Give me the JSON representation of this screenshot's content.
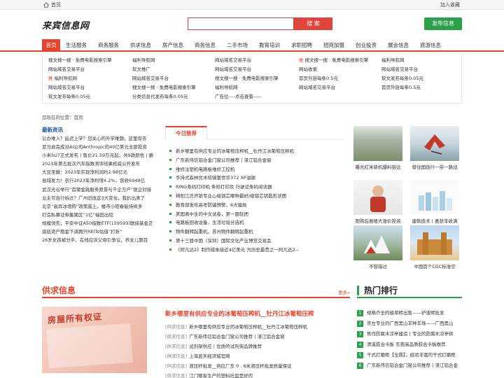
{
  "topbar": {
    "home_label": "首页",
    "favorite_label": "加入收藏"
  },
  "header": {
    "logo": "来宾信息网",
    "search_placeholder": "",
    "search_button": "搜 索",
    "publish_button": "发布信息"
  },
  "nav": {
    "items": [
      "首页",
      "生活服务",
      "商务服务",
      "供求信息",
      "房产信息",
      "商务信息",
      "二手市场",
      "教育培训",
      "求职招聘",
      "招商加盟",
      "创业投资",
      "展会信息",
      "旅游信息"
    ]
  },
  "quick_links": {
    "col1": [
      "搜文搜一搜 · 免费电影搜索引擎",
      "网站域名交易平台",
      "推 福利导航网",
      "网站域名交易平台",
      "软文发布每条0.05元"
    ],
    "col2": [
      "福利导航网",
      "软文推广",
      "网站域名交易平台",
      "搜文搜一搜 · 免费电影搜索引擎",
      "分类信息代发布每条0.05元"
    ],
    "col3": [
      "网站域名交易平台",
      "网站域名交易平台",
      "搜文搜一搜 · 免费电影搜索引擎",
      "福利导航网",
      "广告位----点击查看-----"
    ],
    "col4": [
      "推 搜文搜一搜 · 免费电影搜索引擎",
      "网站收录",
      "首页外链每条0.5元",
      "网站域名交易平台"
    ],
    "col5": [
      "福利导航网",
      "网站域名交易平台",
      "软文发布每条0.05元",
      "首页外链每条0.5元"
    ]
  },
  "location": "您现在的位置：首页",
  "latest_news": {
    "title": "最新资讯",
    "items": [
      "公办难入？延迟上学？您关心的升学难题，这里有答",
      "亚马逊完成对AI公司Anthropic的40亿美元全部投资",
      "小米SU7正式发布丨售价21.59万元起，共9款颜色丨爵",
      "2023年第五批次汽车指数测评结果权威公开发布",
      "大显圣徽：2023年实现净利润约2.98亿元",
      "县域发力！农行2023年净利增4.2%，营收6948亿",
      "武汉光谷举行“首聚金融服务愿景与千企万户”银企对接",
      "业主可自行拆迁？广州旧改这3大变化，我扒出来了",
      "北京“高异冰增购”政策座上，楼市小阳春能持续多",
      "打造私募证券集聚区“1亿”福田出招",
      "规模领先，平安中证A50指数ETF(159593)联接基金正",
      "底层资产租金下调再只REITs估值“打折”",
      "26岁女孩被分手，在线控诉父母引争议，养女儿题目"
    ]
  },
  "recommend": {
    "tab": "今日推荐",
    "items": [
      "新乡哪里有供应专业的冰葡萄压榨机__牡丹江冰葡萄压榨机",
      "广东新伟信铝合金门窗公司推荐丨湛江铝合金窗",
      "维修注塑机电路板维修工控机",
      "手持式森林优木结镜富世华372 XP油锯",
      "RING条码打印机 条码打印及 行驶证条码阅读器",
      "绵阳江氏开锁专业心级锁芯哪种最好/级锁芯钥匙形状图",
      "教育部发布高考防骗预警，6大骗局",
      "美国离中生的中文试卷，第一题就把",
      "电路板回收设备，生活垃圾分选机",
      "物件翻转起重机，苏州物件翻转起重机",
      "第十三届中国（深圳）国际文化产业博览交易会",
      "《阿凡达2》制作成本接近4亿美元 为历史最贵之一阿凡达2--"
    ]
  },
  "image_cards": [
    {
      "caption": "曝光红米新机爆料容远"
    },
    {
      "caption": "替往国践行一带一路战"
    },
    {
      "caption": "限购后展楼大涨价投资"
    },
    {
      "caption": "建筑技术丨喜获丰收满"
    },
    {
      "caption": "不容错过"
    },
    {
      "caption": "中国首个CGC标准空"
    }
  ],
  "supply": {
    "title": "供求信息",
    "more": "更多»",
    "image_text": "房屋所有权证",
    "headline": "新乡哪里有供应专业的冰葡萄压榨机__牡丹江冰葡萄压榨",
    "items": [
      {
        "cat": "[供求信息]",
        "text": "新乡哪里有供应专业的冰葡萄压榨机__牡丹江冰葡萄压榨机"
      },
      {
        "cat": "[供求信息]",
        "text": "广东新伟信铝合金门窗公司推荐丨湛江铝合金窗"
      },
      {
        "cat": "[供求信息]",
        "text": "试剂架供应丨优质的试剂架品牌推荐"
      },
      {
        "cat": "[供求信息]",
        "text": "上海蓝天经济城官网"
      },
      {
        "cat": "[供求信息]",
        "text": "液压杆批发__供应厂东 0 . 6米液压杆批发质量保证"
      },
      {
        "cat": "[供求信息]",
        "text": "江门哪家生产的塑料托盘是好的"
      }
    ]
  },
  "hot": {
    "title": "热门排行",
    "items": [
      "规格齐全的植草砖出售——护坡砖批发",
      "崇左专业的广西黑山羊种羊场——广西黑山",
      "焦作防腐木凉亭建造丨专业的防腐木凉亭供",
      "清溪胶合卡板   东莞高品质胶合卡板推荐",
      "干式打磨柜【全鼎】，经验丰富的干式打磨柜",
      "广东新伟信铝合金门窗公司推荐丨湛江铝合金"
    ]
  },
  "colors": {
    "accent_red": "#e5452d",
    "accent_green": "#2aa04a",
    "link_blue": "#1a54a6"
  }
}
